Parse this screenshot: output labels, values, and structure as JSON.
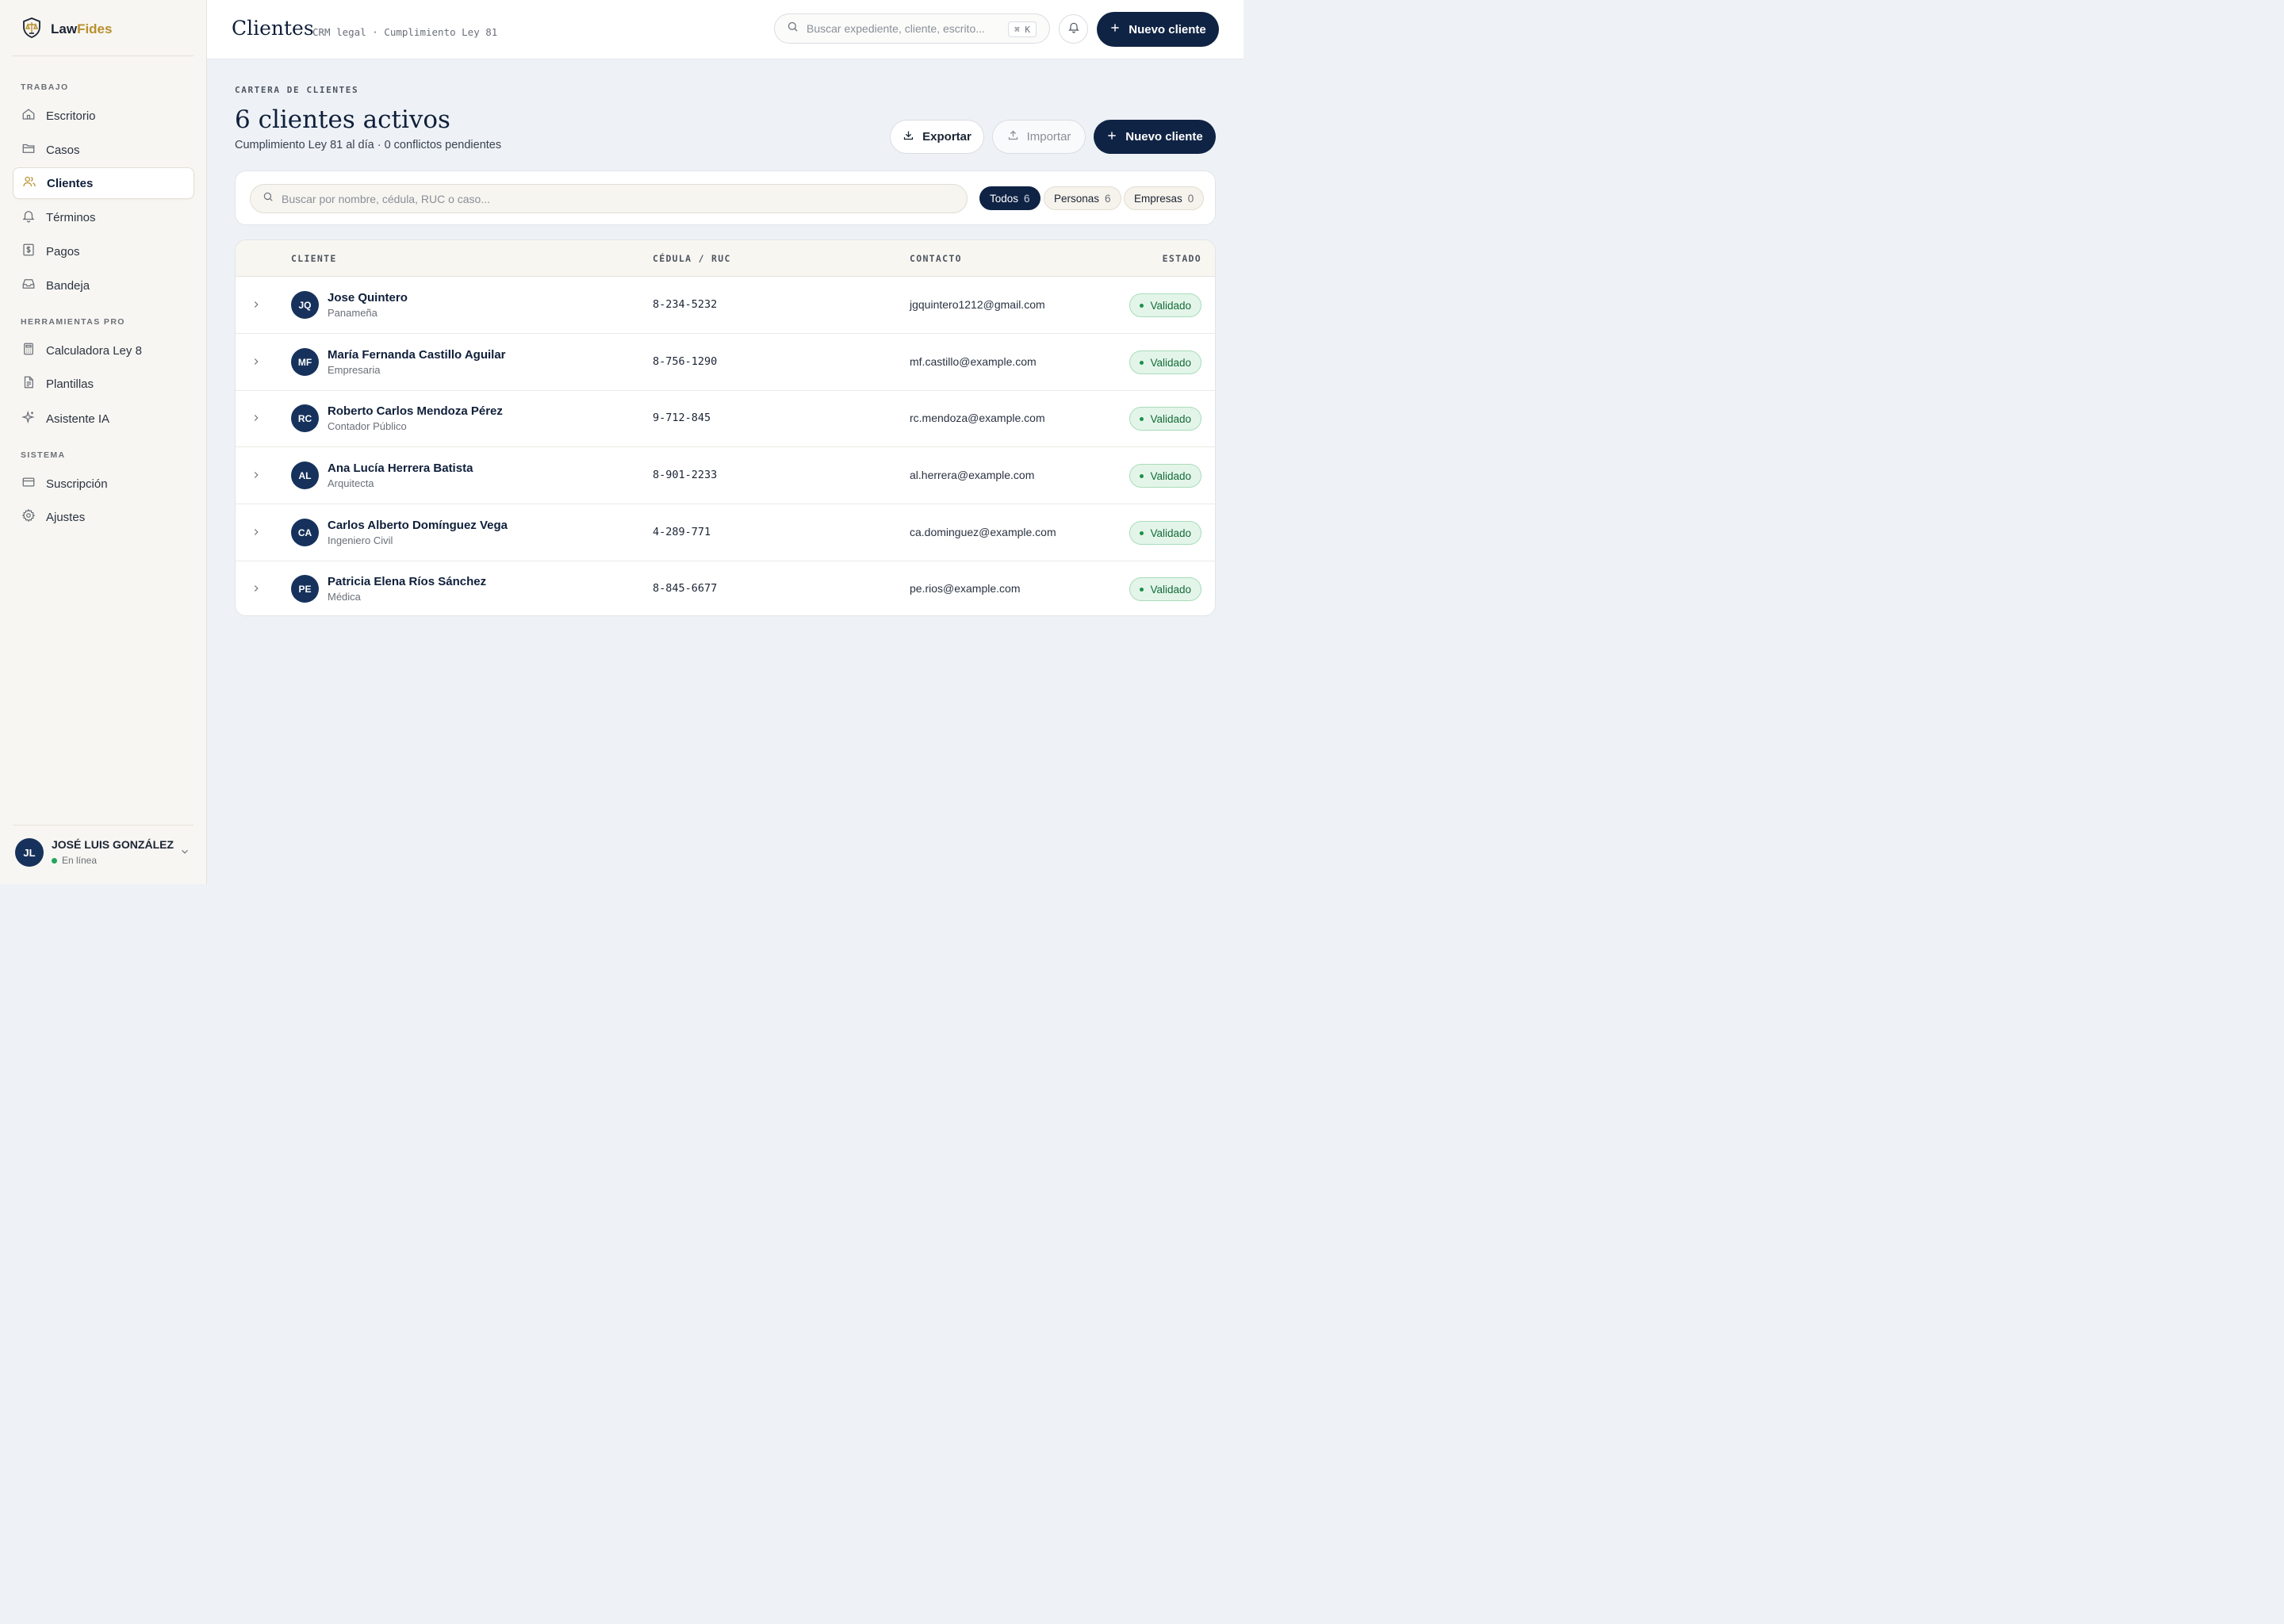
{
  "brand": {
    "name_primary": "Law",
    "name_accent": "Fides"
  },
  "sidebar": {
    "sections": [
      {
        "label": "TRABAJO"
      },
      {
        "label": "HERRAMIENTAS PRO"
      },
      {
        "label": "SISTEMA"
      }
    ],
    "items": [
      {
        "label": "Escritorio",
        "icon": "home-icon"
      },
      {
        "label": "Casos",
        "icon": "folder-icon"
      },
      {
        "label": "Clientes",
        "icon": "users-icon",
        "active": true
      },
      {
        "label": "Términos",
        "icon": "bell-icon"
      },
      {
        "label": "Pagos",
        "icon": "dollar-icon"
      },
      {
        "label": "Bandeja",
        "icon": "inbox-icon"
      },
      {
        "label": "Calculadora Ley 8",
        "icon": "calculator-icon"
      },
      {
        "label": "Plantillas",
        "icon": "document-icon"
      },
      {
        "label": "Asistente IA",
        "icon": "sparkle-icon"
      },
      {
        "label": "Suscripción",
        "icon": "card-icon"
      },
      {
        "label": "Ajustes",
        "icon": "gear-icon"
      }
    ],
    "user": {
      "initials": "JL",
      "name": "JOSÉ LUIS GONZÁLEZ",
      "status": "En línea"
    }
  },
  "header": {
    "title": "Clientes",
    "subtitle": "CRM legal · Cumplimiento Ley 81",
    "search_placeholder": "Buscar expediente, cliente, escrito...",
    "shortcut": "⌘ K",
    "new_button": "Nuevo cliente"
  },
  "main": {
    "eyebrow": "CARTERA DE CLIENTES",
    "title": "6 clientes activos",
    "subtitle": "Cumplimiento Ley 81 al día · 0 conflictos pendientes",
    "export_label": "Exportar",
    "import_label": "Importar",
    "new_label": "Nuevo cliente"
  },
  "filters": {
    "search_placeholder": "Buscar por nombre, cédula, RUC o caso...",
    "chips": [
      {
        "label": "Todos",
        "count": "6",
        "active": true
      },
      {
        "label": "Personas",
        "count": "6"
      },
      {
        "label": "Empresas",
        "count": "0"
      }
    ]
  },
  "table": {
    "columns": [
      "CLIENTE",
      "CÉDULA / RUC",
      "CONTACTO",
      "ESTADO"
    ],
    "rows": [
      {
        "initials": "JQ",
        "name": "Jose Quintero",
        "role": "Panameña",
        "id": "8-234-5232",
        "email": "jgquintero1212@gmail.com",
        "status": "Validado"
      },
      {
        "initials": "MF",
        "name": "María Fernanda Castillo Aguilar",
        "role": "Empresaria",
        "id": "8-756-1290",
        "email": "mf.castillo@example.com",
        "status": "Validado"
      },
      {
        "initials": "RC",
        "name": "Roberto Carlos Mendoza Pérez",
        "role": "Contador Público",
        "id": "9-712-845",
        "email": "rc.mendoza@example.com",
        "status": "Validado"
      },
      {
        "initials": "AL",
        "name": "Ana Lucía Herrera Batista",
        "role": "Arquitecta",
        "id": "8-901-2233",
        "email": "al.herrera@example.com",
        "status": "Validado"
      },
      {
        "initials": "CA",
        "name": "Carlos Alberto Domínguez Vega",
        "role": "Ingeniero Civil",
        "id": "4-289-771",
        "email": "ca.dominguez@example.com",
        "status": "Validado"
      },
      {
        "initials": "PE",
        "name": "Patricia Elena Ríos Sánchez",
        "role": "Médica",
        "id": "8-845-6677",
        "email": "pe.rios@example.com",
        "status": "Validado"
      }
    ]
  },
  "colors": {
    "navy": "#0f2344",
    "gold": "#b8902f",
    "success": "#1f8f4e"
  }
}
